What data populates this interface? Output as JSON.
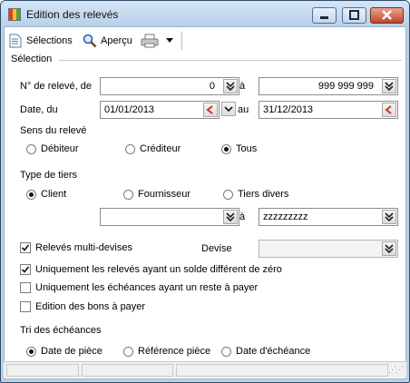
{
  "window": {
    "title": "Edition des relevés",
    "icon": "multicolor-app-icon",
    "controls": {
      "minimize": "minimize-icon",
      "maximize": "maximize-icon",
      "close": "close-icon"
    }
  },
  "toolbar": {
    "selections_label": "Sélections",
    "apercu_label": "Aperçu",
    "print_icon": "printer-icon",
    "dropdown_icon": "chevron-down-icon"
  },
  "selection": {
    "group_label": "Sélection",
    "releve": {
      "label": "N° de relevé, de",
      "from": "0",
      "a_label": "à",
      "to": "999 999 999"
    },
    "date": {
      "label": "Date, du",
      "from": "01/01/2013",
      "au_label": "au",
      "to": "31/12/2013"
    },
    "sens": {
      "label": "Sens du relevé",
      "options": [
        "Débiteur",
        "Créditeur",
        "Tous"
      ],
      "selected": 2
    },
    "type_tiers": {
      "label": "Type de tiers",
      "options": [
        "Client",
        "Fournisseur",
        "Tiers divers"
      ],
      "selected": 0,
      "from": "",
      "a_label": "à",
      "to": "zzzzzzzzz"
    },
    "multidevises": {
      "label": "Relevés multi-devises",
      "checked": true,
      "devise_label": "Devise",
      "devise_value": ""
    },
    "solde_zero": {
      "label": "Uniquement les relevés ayant un solde différent de zéro",
      "checked": true
    },
    "reste_payer": {
      "label": "Uniquement les échéances ayant un reste à payer",
      "checked": false
    },
    "bons_payer": {
      "label": "Edition des bons à payer",
      "checked": false
    },
    "tri": {
      "label": "Tri des échéances",
      "options": [
        "Date de pièce",
        "Référence pièce",
        "Date d'échéance"
      ],
      "selected": 0
    }
  },
  "colors": {
    "title_bar": "#c4d7ec",
    "close_button": "#c2432b",
    "field_border": "#8c8c8c"
  }
}
